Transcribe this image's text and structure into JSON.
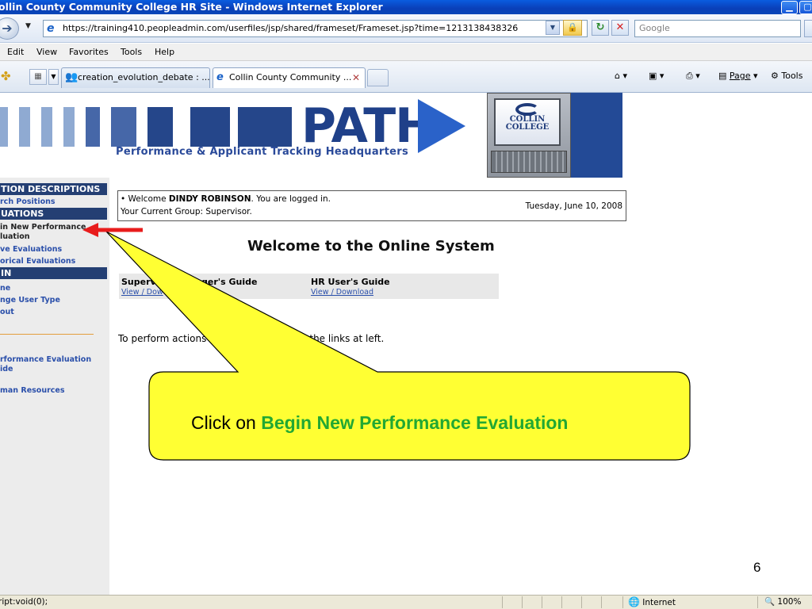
{
  "window": {
    "title": "ollin County Community College HR Site - Windows Internet Explorer"
  },
  "address": {
    "url": "https://training410.peopleadmin.com/userfiles/jsp/shared/frameset/Frameset.jsp?time=1213138438326",
    "search_placeholder": "Google"
  },
  "menu": [
    "Edit",
    "View",
    "Favorites",
    "Tools",
    "Help"
  ],
  "tabs": [
    {
      "label": "creation_evolution_debate : ...",
      "active": false
    },
    {
      "label": "Collin County Community ...",
      "active": true
    }
  ],
  "commands": {
    "page": "Page",
    "tools": "Tools"
  },
  "banner": {
    "logo_text": "PATH",
    "subtitle": "Performance & Applicant Tracking Headquarters",
    "college_name_line1": "COLLIN",
    "college_name_line2": "COLLEGE"
  },
  "sidebar": {
    "sections": [
      {
        "heading": "TION DESCRIPTIONS",
        "links": [
          "rch Positions"
        ]
      },
      {
        "heading": "UATIONS",
        "links": [
          "in New Performance",
          "luation",
          "ve Evaluations",
          "orical Evaluations"
        ]
      },
      {
        "heading": "IN",
        "links": [
          "ne",
          "nge User Type",
          "out"
        ]
      }
    ],
    "extra_links": [
      "rformance Evaluation",
      "ide",
      "man Resources"
    ]
  },
  "welcome": {
    "prefix": "• Welcome ",
    "user": "DINDY ROBINSON",
    "suffix": ". You are logged in.",
    "group": "Your Current Group: Supervisor.",
    "date": "Tuesday, June 10, 2008"
  },
  "main": {
    "title": "Welcome to the Online System",
    "guides": [
      {
        "title": "Superv",
        "title_tail": "ger's Guide",
        "link": "View / Dow"
      },
      {
        "title": "HR User's Guide",
        "link": "View / Download"
      }
    ],
    "instructions_start": "To perform actions",
    "instructions_end": "the links at left."
  },
  "callout": {
    "prefix": "Click on ",
    "highlight": "Begin New Performance Evaluation",
    "fill": "#ffff33",
    "arrow_color": "#e81c1c"
  },
  "slide_number": "6",
  "status": {
    "text": "ript:void(0);",
    "zone": "Internet",
    "zoom": "100%"
  }
}
